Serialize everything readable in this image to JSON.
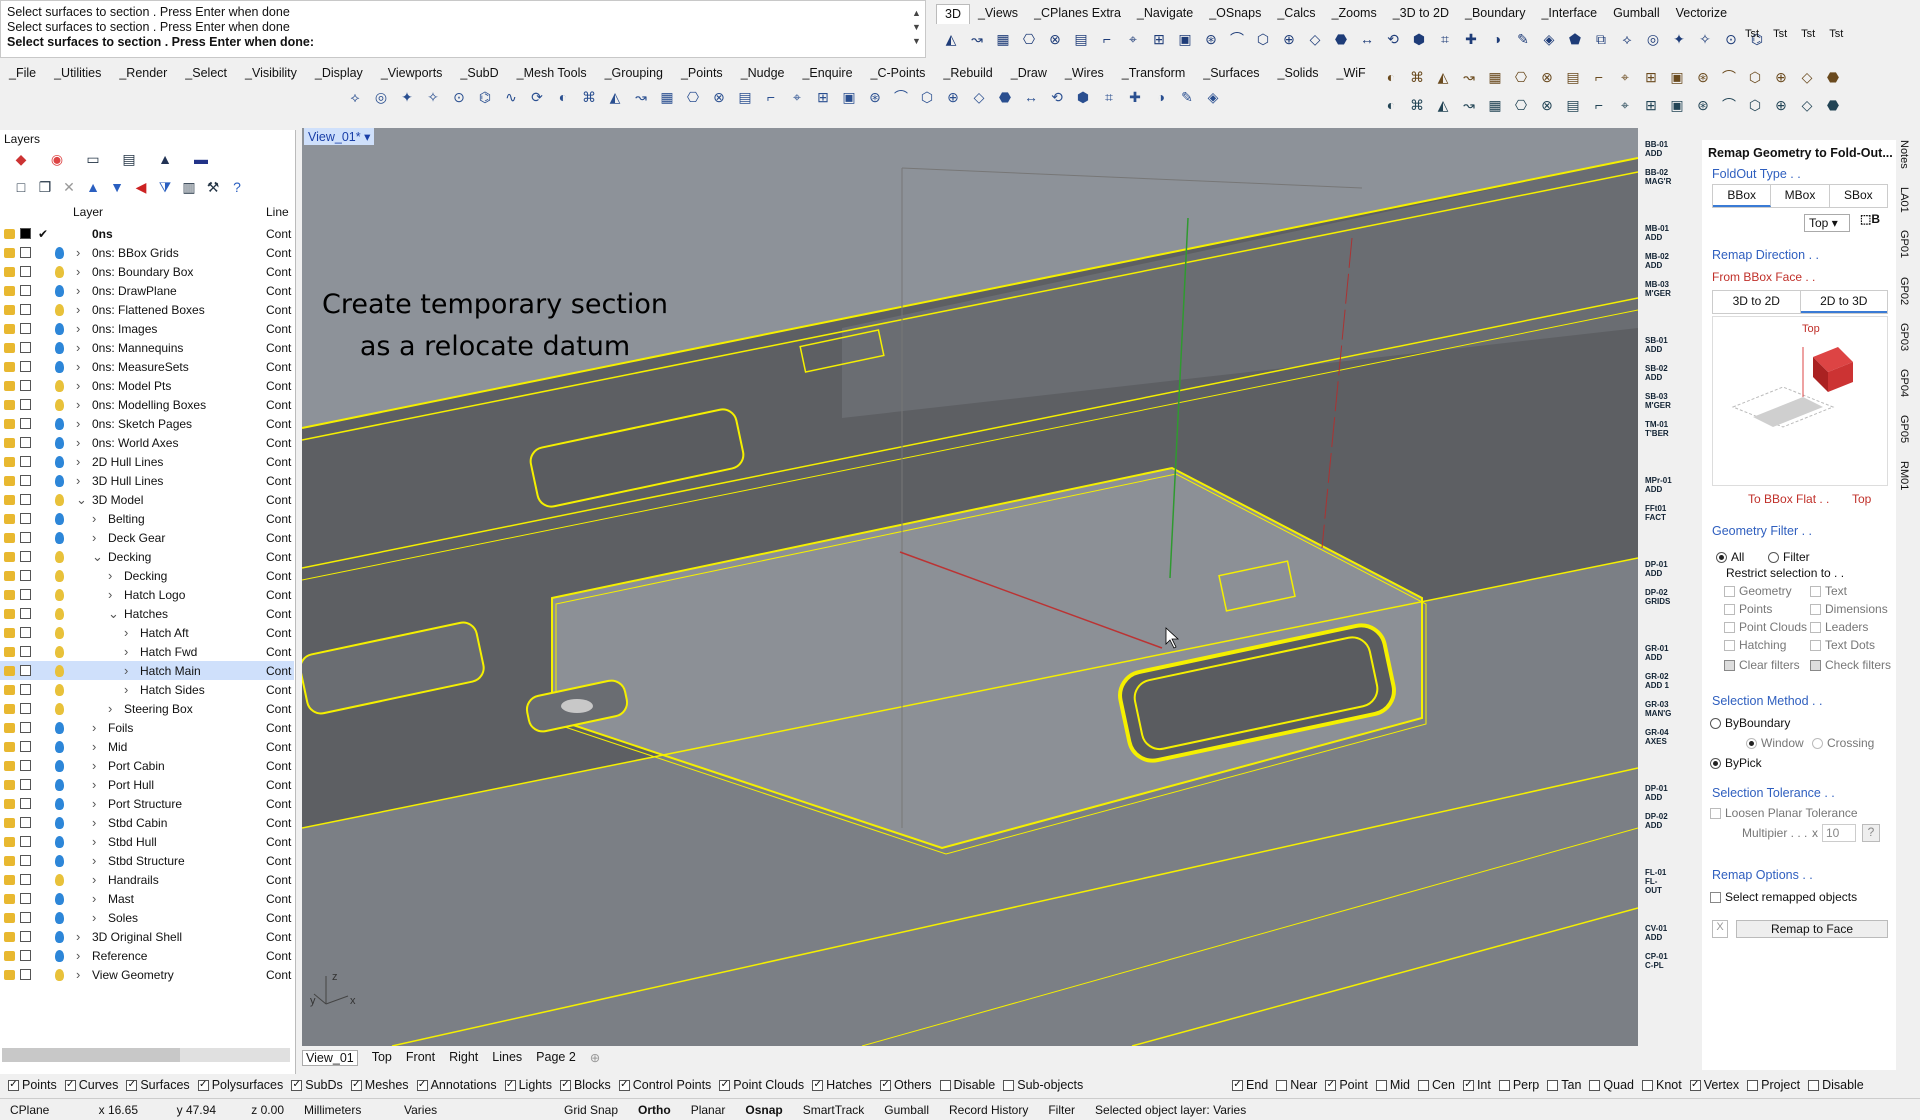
{
  "command": {
    "history": [
      "Select surfaces to section . Press Enter when done",
      "Select surfaces to section . Press Enter when done",
      "Select surfaces to section . Press Enter when done:"
    ]
  },
  "toolbar_tabs": [
    "3D",
    "_Views",
    "_CPlanes Extra",
    "_Navigate",
    "_OSnaps",
    "_Calcs",
    "_Zooms",
    "_3D to 2D",
    "_Boundary",
    "_Interface",
    "Gumball",
    "Vectorize"
  ],
  "toolbar_tst": [
    "Tst",
    "Tst",
    "Tst",
    "Tst"
  ],
  "menu": [
    "_File",
    "_Utilities",
    "_Render",
    "_Select",
    "_Visibility",
    "_Display",
    "_Viewports",
    "_SubD",
    "_Mesh Tools",
    "_Grouping",
    "_Points",
    "_Nudge",
    "_Enquire",
    "_C-Points",
    "_Rebuild",
    "_Draw",
    "_Wires",
    "_Transform",
    "_Surfaces",
    "_Solids",
    "_WiF"
  ],
  "layers": {
    "title": "Layers",
    "col_layer": "Layer",
    "col_line": "Line",
    "rows": [
      {
        "name": "0ns",
        "indent": 0,
        "cont": "Cont",
        "bold": true,
        "bulb": "none",
        "arrow": ""
      },
      {
        "name": "0ns: BBox Grids",
        "indent": 0,
        "cont": "Cont",
        "bulb": "on",
        "arrow": ">"
      },
      {
        "name": "0ns: Boundary Box",
        "indent": 0,
        "cont": "Cont",
        "bulb": "off",
        "arrow": ">"
      },
      {
        "name": "0ns: DrawPlane",
        "indent": 0,
        "cont": "Cont",
        "bulb": "on",
        "arrow": ">"
      },
      {
        "name": "0ns: Flattened Boxes",
        "indent": 0,
        "cont": "Cont",
        "bulb": "off",
        "arrow": ">"
      },
      {
        "name": "0ns: Images",
        "indent": 0,
        "cont": "Cont",
        "bulb": "on",
        "arrow": ">"
      },
      {
        "name": "0ns: Mannequins",
        "indent": 0,
        "cont": "Cont",
        "bulb": "on",
        "arrow": ">"
      },
      {
        "name": "0ns: MeasureSets",
        "indent": 0,
        "cont": "Cont",
        "bulb": "on",
        "arrow": ">"
      },
      {
        "name": "0ns: Model Pts",
        "indent": 0,
        "cont": "Cont",
        "bulb": "off",
        "arrow": ">"
      },
      {
        "name": "0ns: Modelling Boxes",
        "indent": 0,
        "cont": "Cont",
        "bulb": "off",
        "arrow": ">"
      },
      {
        "name": "0ns: Sketch Pages",
        "indent": 0,
        "cont": "Cont",
        "bulb": "on",
        "arrow": ">"
      },
      {
        "name": "0ns: World Axes",
        "indent": 0,
        "cont": "Cont",
        "bulb": "on",
        "arrow": ">"
      },
      {
        "name": "2D Hull Lines",
        "indent": 0,
        "cont": "Cont",
        "bulb": "on",
        "arrow": ">"
      },
      {
        "name": "3D Hull Lines",
        "indent": 0,
        "cont": "Cont",
        "bulb": "on",
        "arrow": ">"
      },
      {
        "name": "3D Model",
        "indent": 0,
        "cont": "Cont",
        "bulb": "off",
        "arrow": "v"
      },
      {
        "name": "Belting",
        "indent": 1,
        "cont": "Cont",
        "bulb": "on",
        "arrow": ">"
      },
      {
        "name": "Deck Gear",
        "indent": 1,
        "cont": "Cont",
        "bulb": "on",
        "arrow": ">"
      },
      {
        "name": "Decking",
        "indent": 1,
        "cont": "Cont",
        "bulb": "off",
        "arrow": "v"
      },
      {
        "name": "Decking",
        "indent": 2,
        "cont": "Cont",
        "bulb": "off",
        "arrow": ">"
      },
      {
        "name": "Hatch Logo",
        "indent": 2,
        "cont": "Cont",
        "bulb": "off",
        "arrow": ">"
      },
      {
        "name": "Hatches",
        "indent": 2,
        "cont": "Cont",
        "bulb": "off",
        "arrow": "v"
      },
      {
        "name": "Hatch Aft",
        "indent": 3,
        "cont": "Cont",
        "bulb": "off",
        "arrow": ">"
      },
      {
        "name": "Hatch Fwd",
        "indent": 3,
        "cont": "Cont",
        "bulb": "off",
        "arrow": ">"
      },
      {
        "name": "Hatch Main",
        "indent": 3,
        "cont": "Cont",
        "bulb": "off",
        "arrow": ">",
        "selected": true
      },
      {
        "name": "Hatch Sides",
        "indent": 3,
        "cont": "Cont",
        "bulb": "off",
        "arrow": ">"
      },
      {
        "name": "Steering Box",
        "indent": 2,
        "cont": "Cont",
        "bulb": "off",
        "arrow": ">"
      },
      {
        "name": "Foils",
        "indent": 1,
        "cont": "Cont",
        "bulb": "on",
        "arrow": ">"
      },
      {
        "name": "Mid",
        "indent": 1,
        "cont": "Cont",
        "bulb": "on",
        "arrow": ">"
      },
      {
        "name": "Port Cabin",
        "indent": 1,
        "cont": "Cont",
        "bulb": "on",
        "arrow": ">"
      },
      {
        "name": "Port Hull",
        "indent": 1,
        "cont": "Cont",
        "bulb": "on",
        "arrow": ">"
      },
      {
        "name": "Port Structure",
        "indent": 1,
        "cont": "Cont",
        "bulb": "on",
        "arrow": ">"
      },
      {
        "name": "Stbd Cabin",
        "indent": 1,
        "cont": "Cont",
        "bulb": "on",
        "arrow": ">"
      },
      {
        "name": "Stbd Hull",
        "indent": 1,
        "cont": "Cont",
        "bulb": "on",
        "arrow": ">"
      },
      {
        "name": "Stbd Structure",
        "indent": 1,
        "cont": "Cont",
        "bulb": "on",
        "arrow": ">"
      },
      {
        "name": "Handrails",
        "indent": 1,
        "cont": "Cont",
        "bulb": "off",
        "arrow": ">"
      },
      {
        "name": "Mast",
        "indent": 1,
        "cont": "Cont",
        "bulb": "on",
        "arrow": ">"
      },
      {
        "name": "Soles",
        "indent": 1,
        "cont": "Cont",
        "bulb": "on",
        "arrow": ">"
      },
      {
        "name": "3D Original Shell",
        "indent": 0,
        "cont": "Cont",
        "bulb": "on",
        "arrow": ">"
      },
      {
        "name": "Reference",
        "indent": 0,
        "cont": "Cont",
        "bulb": "on",
        "arrow": ">"
      },
      {
        "name": "View Geometry",
        "indent": 0,
        "cont": "Cont",
        "bulb": "off",
        "arrow": ">"
      }
    ]
  },
  "viewport": {
    "name": "View_01*",
    "annotation_line1": "Create temporary section",
    "annotation_line2": "as a relocate datum",
    "tabs": [
      "View_01",
      "Top",
      "Front",
      "Right",
      "Lines",
      "Page 2"
    ]
  },
  "strip_labels": [
    "BB-01 ADD",
    "BB-02 MAG'R",
    "MB-01 ADD",
    "MB-02 ADD",
    "MB-03 M'GER",
    "SB-01 ADD",
    "SB-02 ADD",
    "SB-03 M'GER",
    "TM-01 T'BER",
    "MPr-01 ADD",
    "FFt01 FACT",
    "DP-01 ADD",
    "DP-02 GRIDS",
    "GR-01 ADD",
    "GR-02 ADD 1",
    "GR-03 MAN'G",
    "GR-04 AXES",
    "DP-01 ADD",
    "DP-02 ADD",
    "FL-01 FL-OUT",
    "CV-01 ADD",
    "CP-01 C-PL"
  ],
  "panel": {
    "title": "Remap Geometry to Fold-Out...",
    "foldout_label": "FoldOut Type . .",
    "foldout_tabs": [
      "BBox",
      "MBox",
      "SBox"
    ],
    "view_select": "Top",
    "remap_dir_label": "Remap Direction . .",
    "from_face": "From BBox Face . .",
    "dir_tabs": [
      "3D to 2D",
      "2D to 3D"
    ],
    "diagram_top": "Top",
    "to_flat": "To BBox Flat . .",
    "to_flat_val": "Top",
    "geom_filter_label": "Geometry Filter . .",
    "all": "All",
    "filter": "Filter",
    "restrict": "Restrict selection to . .",
    "filter_items": [
      "Geometry",
      "Text",
      "Points",
      "Dimensions",
      "Point Clouds",
      "Leaders",
      "Hatching",
      "Text Dots"
    ],
    "clear_filters": "Clear filters",
    "check_filters": "Check filters",
    "sel_method_label": "Selection Method . .",
    "by_boundary": "ByBoundary",
    "window": "Window",
    "crossing": "Crossing",
    "by_pick": "ByPick",
    "sel_tol_label": "Selection Tolerance . .",
    "loosen": "Loosen Planar Tolerance",
    "multiplier": "Multipier . . .",
    "mult_x": "x",
    "mult_val": "10",
    "help": "?",
    "remap_opts_label": "Remap Options . .",
    "select_remapped": "Select remapped objects",
    "close_x": "X",
    "remap_button": "Remap to Face"
  },
  "side_tabs": [
    "Notes",
    "LA01",
    "GP01",
    "GP02",
    "GP03",
    "GP04",
    "GP05",
    "RM01"
  ],
  "filters": [
    {
      "label": "Points",
      "on": true
    },
    {
      "label": "Curves",
      "on": true
    },
    {
      "label": "Surfaces",
      "on": true
    },
    {
      "label": "Polysurfaces",
      "on": true
    },
    {
      "label": "SubDs",
      "on": true
    },
    {
      "label": "Meshes",
      "on": true
    },
    {
      "label": "Annotations",
      "on": true
    },
    {
      "label": "Lights",
      "on": true
    },
    {
      "label": "Blocks",
      "on": true
    },
    {
      "label": "Control Points",
      "on": true
    },
    {
      "label": "Point Clouds",
      "on": true
    },
    {
      "label": "Hatches",
      "on": true
    },
    {
      "label": "Others",
      "on": true
    },
    {
      "label": "Disable",
      "on": false
    },
    {
      "label": "Sub-objects",
      "on": false
    }
  ],
  "osnaps": [
    {
      "label": "End",
      "on": true
    },
    {
      "label": "Near",
      "on": false
    },
    {
      "label": "Point",
      "on": true
    },
    {
      "label": "Mid",
      "on": false
    },
    {
      "label": "Cen",
      "on": false
    },
    {
      "label": "Int",
      "on": true
    },
    {
      "label": "Perp",
      "on": false
    },
    {
      "label": "Tan",
      "on": false
    },
    {
      "label": "Quad",
      "on": false
    },
    {
      "label": "Knot",
      "on": false
    },
    {
      "label": "Vertex",
      "on": true
    },
    {
      "label": "Project",
      "on": false
    },
    {
      "label": "Disable",
      "on": false
    }
  ],
  "status": {
    "cplane": "CPlane",
    "x": "x 16.65",
    "y": "y 47.94",
    "z": "z 0.00",
    "units": "Millimeters",
    "layer": "Varies",
    "items": [
      "Grid Snap",
      "Ortho",
      "Planar",
      "Osnap",
      "SmartTrack",
      "Gumball",
      "Record History",
      "Filter"
    ],
    "bold_items": [
      "Ortho",
      "Osnap"
    ],
    "message": "Selected object layer: Varies"
  },
  "colors": {
    "accent": "#3a7bd5",
    "wire_yellow": "#f5f000",
    "viewport_bg": "#8d9299",
    "deck_dark": "#5a5c60"
  }
}
